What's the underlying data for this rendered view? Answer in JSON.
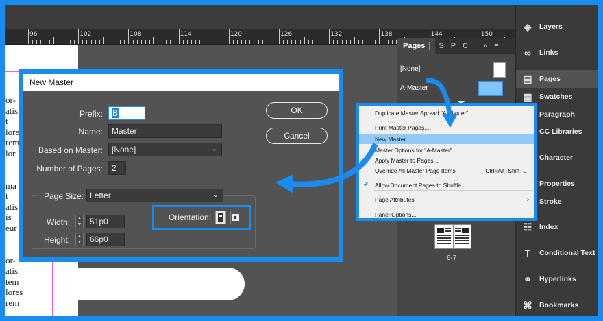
{
  "ruler": {
    "labels": [
      "96",
      "102",
      "108",
      "114",
      "120",
      "126",
      "132",
      "138",
      "144",
      "150"
    ]
  },
  "document": {
    "text_fragments": [
      "or-",
      "atis",
      "t",
      "lore",
      "rem",
      "lor",
      "ma",
      "t",
      "atis",
      "is",
      "eur",
      "or-",
      "atis",
      "tem",
      "lores",
      "rem"
    ]
  },
  "pages_panel": {
    "tabs": [
      "Pages",
      "S",
      "P",
      "C"
    ],
    "overflow_symbol": "»",
    "menu_symbol": "≡",
    "masters": [
      "[None]",
      "A-Master"
    ],
    "spread_label": "6-7"
  },
  "right_panel": {
    "items": [
      {
        "label": "Layers",
        "icon": "layers-icon",
        "glyph": "◈"
      },
      {
        "label": "Links",
        "icon": "links-icon",
        "glyph": "∞"
      },
      {
        "label": "Pages",
        "icon": "pages-icon",
        "glyph": "▤"
      },
      {
        "label": "Swatches",
        "icon": "swatches-icon",
        "glyph": "▦"
      },
      {
        "label": "Paragraph",
        "icon": "paragraph-icon",
        "glyph": "¶"
      },
      {
        "label": "CC Libraries",
        "icon": "cc-libraries-icon",
        "glyph": "☁"
      },
      {
        "label": "Character",
        "icon": "character-icon",
        "glyph": "A"
      },
      {
        "label": "Properties",
        "icon": "properties-icon",
        "glyph": "☰"
      },
      {
        "label": "Stroke",
        "icon": "stroke-icon",
        "glyph": "≡"
      },
      {
        "label": "Index",
        "icon": "index-icon",
        "glyph": "☷"
      },
      {
        "label": "Conditional Text",
        "icon": "conditional-text-icon",
        "glyph": "T"
      },
      {
        "label": "Hyperlinks",
        "icon": "hyperlinks-icon",
        "glyph": "⚭"
      },
      {
        "label": "Bookmarks",
        "icon": "bookmarks-icon",
        "glyph": "⌘"
      }
    ],
    "active": "Pages"
  },
  "menu": {
    "items": [
      {
        "label": "Duplicate Master Spread \"A-Master\""
      },
      {
        "label": "Print Master Pages..."
      },
      {
        "label": "New Master..."
      },
      {
        "label": "Master Options for \"A-Master\"..."
      },
      {
        "label": "Apply Master to Pages..."
      },
      {
        "label": "Override All Master Page Items",
        "shortcut": "Ctrl+Alt+Shift+L"
      },
      {
        "label": "Allow Document Pages to Shuffle",
        "checked": true
      },
      {
        "label": "Page Attributes"
      },
      {
        "label": "Panel Options..."
      }
    ],
    "highlighted": "New Master...",
    "submenu_arrow": "›",
    "check_glyph": "✔"
  },
  "dialog": {
    "title": "New Master",
    "prefix_label": "Prefix:",
    "prefix_value": "B",
    "name_label": "Name:",
    "name_value": "Master",
    "based_on_label": "Based on Master:",
    "based_on_value": "[None]",
    "num_pages_label": "Number of Pages:",
    "num_pages_value": "2",
    "page_size_label": "Page Size:",
    "page_size_value": "Letter",
    "width_label": "Width:",
    "width_value": "51p0",
    "height_label": "Height:",
    "height_value": "66p0",
    "orientation_label": "Orientation:",
    "ok_label": "OK",
    "cancel_label": "Cancel"
  },
  "colors": {
    "accent": "#1a8cf0",
    "highlight": "#91c9f7"
  }
}
